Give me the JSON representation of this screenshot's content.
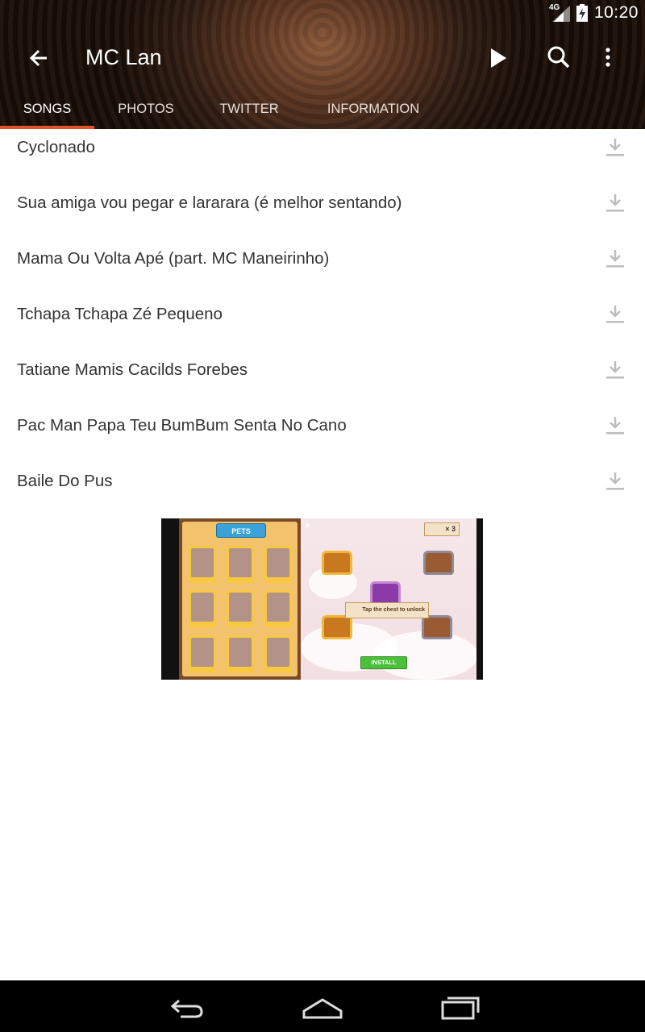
{
  "status_bar": {
    "network": "4G",
    "time": "10:20"
  },
  "toolbar": {
    "title": "MC Lan",
    "icons": [
      "back-arrow-icon",
      "play-icon",
      "search-icon",
      "more-vert-icon"
    ]
  },
  "tabs": [
    {
      "label": "SONGS",
      "active": true
    },
    {
      "label": "PHOTOS",
      "active": false
    },
    {
      "label": "TWITTER",
      "active": false
    },
    {
      "label": "INFORMATION",
      "active": false
    }
  ],
  "colors": {
    "accent": "#e2522a",
    "text": "#333333",
    "icon_grey": "#bdbdbd"
  },
  "songs": [
    {
      "title": "Cyclonado"
    },
    {
      "title": "Sua amiga vou pegar e lararara (é melhor sentando)"
    },
    {
      "title": "Mama Ou Volta Apé (part. MC Maneirinho)"
    },
    {
      "title": "Tchapa Tchapa Zé Pequeno"
    },
    {
      "title": "Tatiane Mamis Cacilds Forebes"
    },
    {
      "title": "Pac Man Papa Teu BumBum Senta No Cano"
    },
    {
      "title": "Baile Do Pus"
    }
  ],
  "ad": {
    "pets_label": "PETS",
    "keys_label": "× 3",
    "tap_label": "Tap the chest to unlock",
    "install_label": "INSTALL"
  },
  "nav_bar": {
    "icons": [
      "back-nav-icon",
      "home-nav-icon",
      "recents-nav-icon"
    ]
  }
}
